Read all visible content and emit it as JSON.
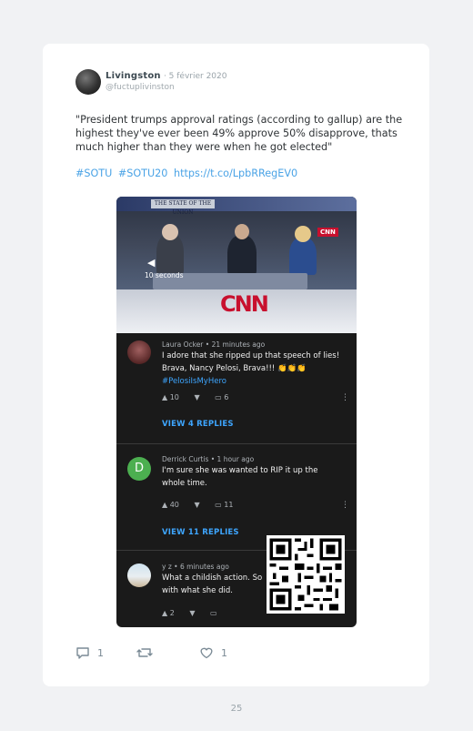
{
  "tweet": {
    "display_name": "Livingston",
    "date": "· 5 février 2020",
    "handle": "@fuctuplivinston",
    "text": "\"President trumps approval ratings (according to gallup) are the highest they've ever been 49% approve 50% disapprove, thats much higher than they were when he got elected\"",
    "hashtags": [
      "#SOTU",
      "#SOTU20"
    ],
    "link": "https://t.co/LpbRRegEV0"
  },
  "video": {
    "banner_text": "THE STATE OF THE UNION",
    "logo_text": "CNN",
    "logo_small": "CNN",
    "timer_text": "10 seconds"
  },
  "comments": [
    {
      "author_meta": "Laura Ocker • 21 minutes ago",
      "body_lines": [
        "I adore that she ripped up that speech of lies!",
        "Brava, Nancy Pelosi, Brava!!! 👏👏👏"
      ],
      "hashtag": "#PelosiIsMyHero",
      "likes": "10",
      "replies_count": "6",
      "view_replies": "VIEW 4 REPLIES",
      "avatar_letter": ""
    },
    {
      "author_meta": "Derrick Curtis • 1 hour ago",
      "body_lines": [
        "I'm sure she was wanted to RIP it up the",
        "whole time."
      ],
      "hashtag": "",
      "likes": "40",
      "replies_count": "11",
      "view_replies": "VIEW 11 REPLIES",
      "avatar_letter": "D"
    },
    {
      "author_meta": "y z • 6 minutes ago",
      "body_lines": [
        "What a childish action. So",
        "with what she did."
      ],
      "hashtag": "",
      "likes": "2",
      "replies_count": "",
      "view_replies": "",
      "avatar_letter": ""
    }
  ],
  "actions": {
    "reply_count": "1",
    "retweet_count": "",
    "like_count": "1"
  },
  "page_number": "25",
  "colors": {
    "link_blue": "#4aa3e6",
    "yt_blue": "#3ea6ff",
    "cnn_red": "#c8102e",
    "avatar_green": "#4caf50"
  },
  "icons": [
    "reply-icon",
    "retweet-icon",
    "like-icon",
    "thumbs-up-icon",
    "thumbs-down-icon",
    "reply-bubble-icon",
    "more-vert-icon",
    "play-icon"
  ]
}
